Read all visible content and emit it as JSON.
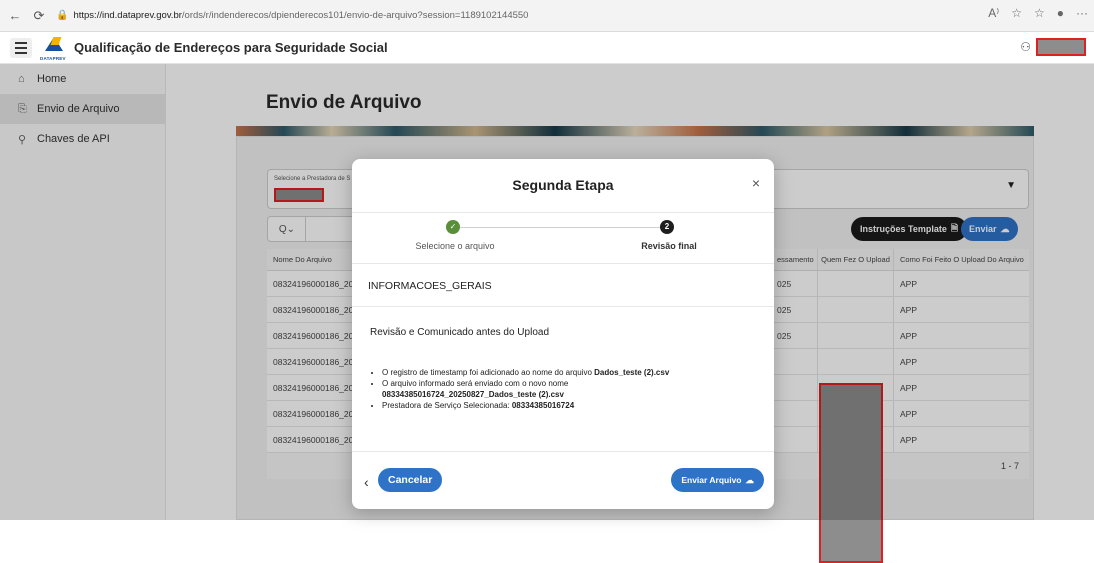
{
  "browser": {
    "back_icon": "←",
    "reload_icon": "⟳",
    "url_host": "https://ind.dataprev.gov.br",
    "url_path": "/ords/r/indenderecos/dpienderecos101/envio-de-arquivo?session=1189102144550",
    "right_icons": [
      "A⁾",
      "☆",
      "☆",
      "●",
      "···"
    ]
  },
  "app": {
    "title": "Qualificação de Endereços para Seguridade Social",
    "logo_text": "DATAPREV",
    "user_icon": "user-icon"
  },
  "sidebar": {
    "items": [
      {
        "icon": "⌂",
        "label": "Home",
        "active": false
      },
      {
        "icon": "⎘",
        "label": "Envio de Arquivo",
        "active": true
      },
      {
        "icon": "⚲",
        "label": "Chaves de API",
        "active": false
      }
    ]
  },
  "page": {
    "title": "Envio de Arquivo",
    "select_label": "Selecione a Prestadora de S",
    "search_icon": "Q⌄",
    "btn_instructions": "Instruções Template",
    "btn_send": "Enviar",
    "table": {
      "headers": [
        "Nome Do Arquivo",
        "essamento",
        "Quem Fez O Upload",
        "Como Foi Feito O Upload Do Arquivo"
      ],
      "rows": [
        {
          "name": "08324196000186_202",
          "date": "025",
          "method": "APP"
        },
        {
          "name": "08324196000186_202",
          "date": "025",
          "method": "APP"
        },
        {
          "name": "08324196000186_202",
          "date": "025",
          "method": "APP"
        },
        {
          "name": "08324196000186_202",
          "date": "",
          "method": "APP"
        },
        {
          "name": "08324196000186_202",
          "date": "",
          "method": "APP"
        },
        {
          "name": "08324196000186_202",
          "date": "",
          "method": "APP"
        },
        {
          "name": "08324196000186_202",
          "date": "",
          "method": "APP"
        }
      ],
      "pagination": "1 - 7"
    }
  },
  "modal": {
    "title": "Segunda Etapa",
    "close": "×",
    "step1_label": "Selecione o arquivo",
    "step2_label": "Revisão final",
    "step2_number": "2",
    "step1_check": "✓",
    "section_info": "INFORMACOES_GERAIS",
    "review_heading": "Revisão e Comunicado antes do Upload",
    "bullets": {
      "b1_text": "O registro de timestamp foi adicionado ao nome do arquivo ",
      "b1_file": "Dados_teste (2).csv",
      "b2_text": "O arquivo informado será enviado com o novo nome",
      "b2_file": "08334385016724_20250827_Dados_teste (2).csv",
      "b3_text": "Prestadora de Serviço Selecionada: ",
      "b3_value": "08334385016724"
    },
    "btn_back": "‹",
    "btn_cancel": "Cancelar",
    "btn_send": "Enviar Arquivo"
  },
  "colors": {
    "primary": "#2f73c9",
    "redaction": "#e02020",
    "step_done": "#5a8f3a"
  }
}
